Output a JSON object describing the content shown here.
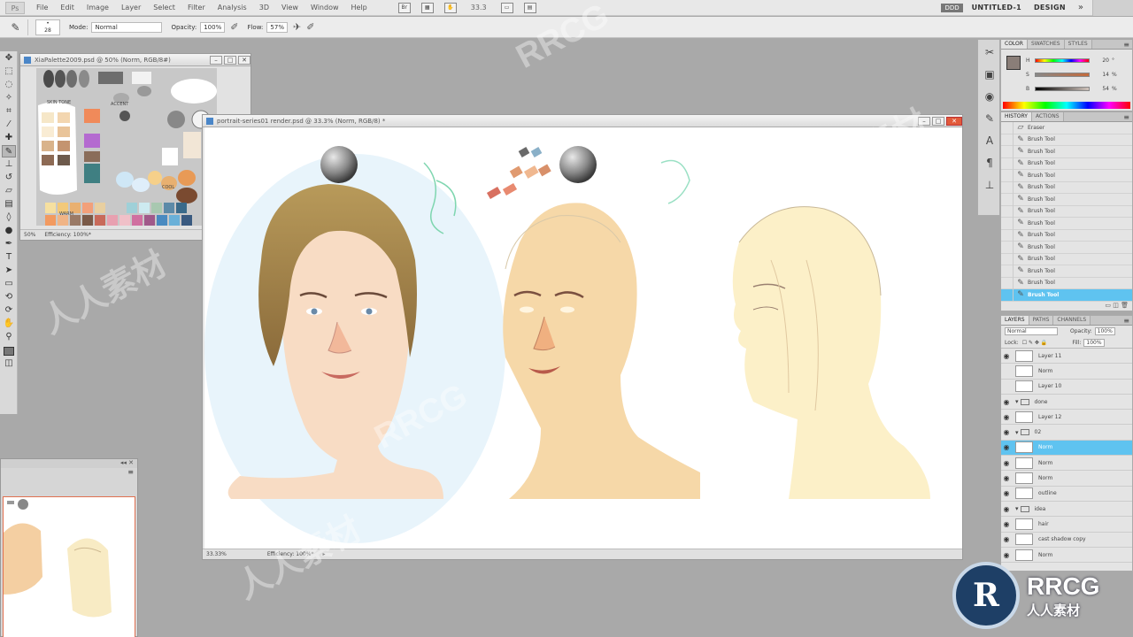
{
  "menubar": {
    "items": [
      "File",
      "Edit",
      "Image",
      "Layer",
      "Select",
      "Filter",
      "Analysis",
      "3D",
      "View",
      "Window",
      "Help"
    ],
    "zoom": "33.3",
    "workspace_chip": "DDD",
    "workspace_name": "UNTITLED-1",
    "workspace_design": "DESIGN",
    "more": "»"
  },
  "optbar": {
    "brush_size": "28",
    "mode_label": "Mode:",
    "mode_value": "Normal",
    "opacity_label": "Opacity:",
    "opacity_value": "100%",
    "flow_label": "Flow:",
    "flow_value": "57%"
  },
  "tools": [
    "move",
    "marquee",
    "lasso",
    "quick-select",
    "crop",
    "eyedropper",
    "healing",
    "brush",
    "clone-stamp",
    "history-brush",
    "eraser",
    "gradient",
    "blur",
    "dodge",
    "pen",
    "type",
    "path-select",
    "shape",
    "3d-rotate",
    "3d-camera",
    "hand",
    "zoom"
  ],
  "palette_doc": {
    "title": "XiaPalette2009.psd @ 50% (Norm, RGB/8#)",
    "zoom": "50%",
    "efficiency": "Efficiency: 100%*",
    "labels": {
      "skin": "SKIN TONE",
      "accent": "ACCENT",
      "warm": "WARM",
      "cool": "COOL"
    }
  },
  "main_doc": {
    "title": "portrait-series01 render.psd @ 33.3% (Norm, RGB/8) *",
    "zoom": "33.33%",
    "efficiency": "Efficiency: 100%*"
  },
  "color_panel": {
    "tabs": [
      "COLOR",
      "SWATCHES",
      "STYLES"
    ],
    "rows": [
      {
        "label": "H",
        "value": "20",
        "unit": "°"
      },
      {
        "label": "S",
        "value": "14",
        "unit": "%"
      },
      {
        "label": "B",
        "value": "54",
        "unit": "%"
      }
    ]
  },
  "history_panel": {
    "tabs": [
      "HISTORY",
      "ACTIONS"
    ],
    "items": [
      "Eraser",
      "Brush Tool",
      "Brush Tool",
      "Brush Tool",
      "Brush Tool",
      "Brush Tool",
      "Brush Tool",
      "Brush Tool",
      "Brush Tool",
      "Brush Tool",
      "Brush Tool",
      "Brush Tool",
      "Brush Tool",
      "Brush Tool",
      "Brush Tool"
    ]
  },
  "layers_panel": {
    "tabs": [
      "LAYERS",
      "PATHS",
      "CHANNELS"
    ],
    "blend_mode": "Normal",
    "opacity_label": "Opacity:",
    "opacity_value": "100%",
    "lock_label": "Lock:",
    "fill_label": "Fill:",
    "fill_value": "100%",
    "layers": [
      {
        "name": "Layer 11",
        "visible": true,
        "type": "layer"
      },
      {
        "name": "Norm",
        "visible": false,
        "type": "layer"
      },
      {
        "name": "Layer 10",
        "visible": false,
        "type": "layer"
      },
      {
        "name": "done",
        "visible": true,
        "type": "group"
      },
      {
        "name": "Layer 12",
        "visible": true,
        "type": "layer"
      },
      {
        "name": "02",
        "visible": true,
        "type": "group"
      },
      {
        "name": "Norm",
        "visible": true,
        "type": "layer",
        "active": true
      },
      {
        "name": "Norm",
        "visible": true,
        "type": "layer"
      },
      {
        "name": "Norm",
        "visible": true,
        "type": "layer"
      },
      {
        "name": "outline",
        "visible": true,
        "type": "layer"
      },
      {
        "name": "idea",
        "visible": true,
        "type": "group"
      },
      {
        "name": "hair",
        "visible": true,
        "type": "layer"
      },
      {
        "name": "cast shadow copy",
        "visible": true,
        "type": "layer"
      },
      {
        "name": "Norm",
        "visible": true,
        "type": "layer"
      }
    ]
  },
  "watermark": {
    "big": "RRCG",
    "small": "人人素材",
    "overlay": "RRCG",
    "overlay_cn": "人人素材"
  },
  "colors": {
    "history_active": "#5fc3f0",
    "layer_active": "#5fc3f0",
    "close_btn": "#e25a3a",
    "nav_frame": "#e07050"
  }
}
